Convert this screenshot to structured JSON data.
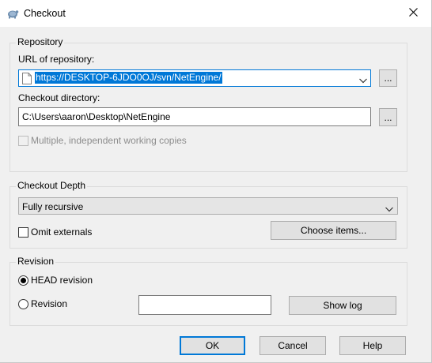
{
  "window": {
    "title": "Checkout",
    "icon": "tortoisesvn-icon",
    "close_icon": "close-icon"
  },
  "repository": {
    "group_label": "Repository",
    "url_label": "URL of repository:",
    "url_value": "https://DESKTOP-6JDO0OJ/svn/NetEngine/",
    "url_browse": "...",
    "dir_label": "Checkout directory:",
    "dir_value": "C:\\Users\\aaron\\Desktop\\NetEngine",
    "dir_browse": "...",
    "multiple_label": "Multiple, independent working copies",
    "multiple_checked": false,
    "multiple_enabled": false
  },
  "depth": {
    "group_label": "Checkout Depth",
    "selected": "Fully recursive",
    "omit_label": "Omit externals",
    "omit_checked": false,
    "choose_items": "Choose items..."
  },
  "revision": {
    "group_label": "Revision",
    "head_label": "HEAD revision",
    "head_selected": true,
    "rev_label": "Revision",
    "rev_value": "",
    "show_log": "Show log"
  },
  "buttons": {
    "ok": "OK",
    "cancel": "Cancel",
    "help": "Help"
  },
  "colors": {
    "accent": "#0078d7",
    "background": "#f0f0f0"
  }
}
